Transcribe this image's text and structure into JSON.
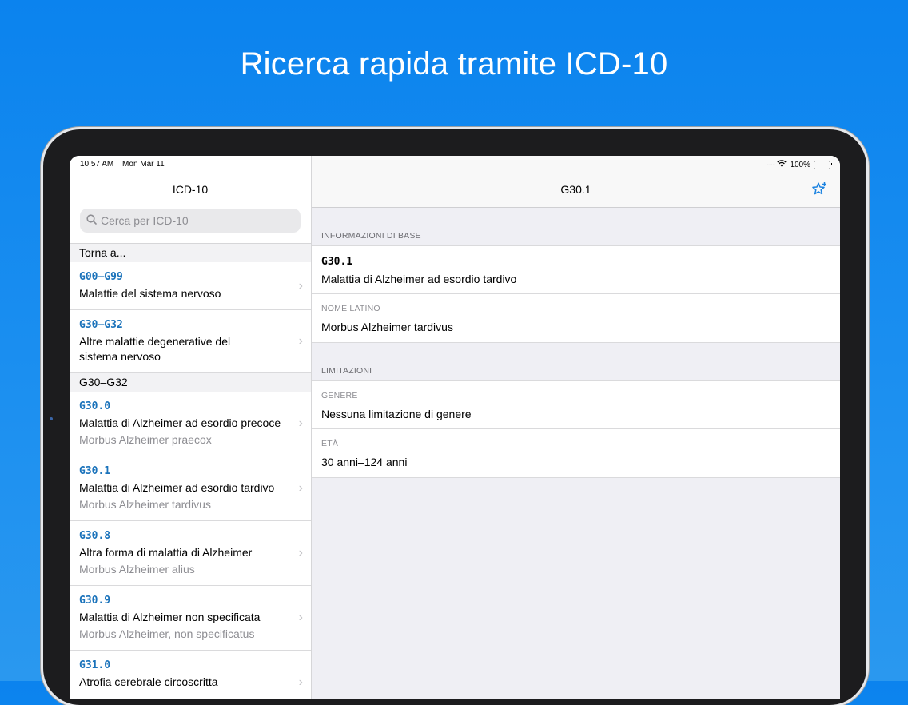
{
  "headline": "Ricerca rapida tramite ICD-10",
  "status": {
    "time": "10:57 AM",
    "date": "Mon Mar 11",
    "battery": "100%"
  },
  "sidebar": {
    "title": "ICD-10",
    "search_placeholder": "Cerca per ICD-10",
    "section_back": "Torna a...",
    "back_items": [
      {
        "code": "G00–G99",
        "title": "Malattie del sistema nervoso"
      },
      {
        "code": "G30–G32",
        "title": "Altre malattie degenerative del sistema nervoso"
      }
    ],
    "section_group": "G30–G32",
    "items": [
      {
        "code": "G30.0",
        "title": "Malattia di Alzheimer ad esordio precoce",
        "latin": "Morbus Alzheimer praecox"
      },
      {
        "code": "G30.1",
        "title": "Malattia di Alzheimer ad esordio tardivo",
        "latin": "Morbus Alzheimer tardivus"
      },
      {
        "code": "G30.8",
        "title": "Altra forma di malattia di Alzheimer",
        "latin": "Morbus Alzheimer alius"
      },
      {
        "code": "G30.9",
        "title": "Malattia di Alzheimer non specificata",
        "latin": "Morbus Alzheimer, non specificatus"
      },
      {
        "code": "G31.0",
        "title": "Atrofia cerebrale circoscritta",
        "latin": ""
      }
    ]
  },
  "detail": {
    "title": "G30.1",
    "favorite_icon": "star-plus-icon",
    "basic_info_header": "INFORMAZIONI DI BASE",
    "code": "G30.1",
    "description": "Malattia di Alzheimer ad esordio tardivo",
    "latin_label": "NOME LATINO",
    "latin_value": "Morbus Alzheimer tardivus",
    "limits_header": "LIMITAZIONI",
    "gender_label": "GENERE",
    "gender_value": "Nessuna limitazione di genere",
    "age_label": "ETÀ",
    "age_value": "30 anni–124 anni"
  },
  "colors": {
    "background": "#0b83ee",
    "code_blue": "#1b73bb",
    "accent": "#1a82e0"
  }
}
